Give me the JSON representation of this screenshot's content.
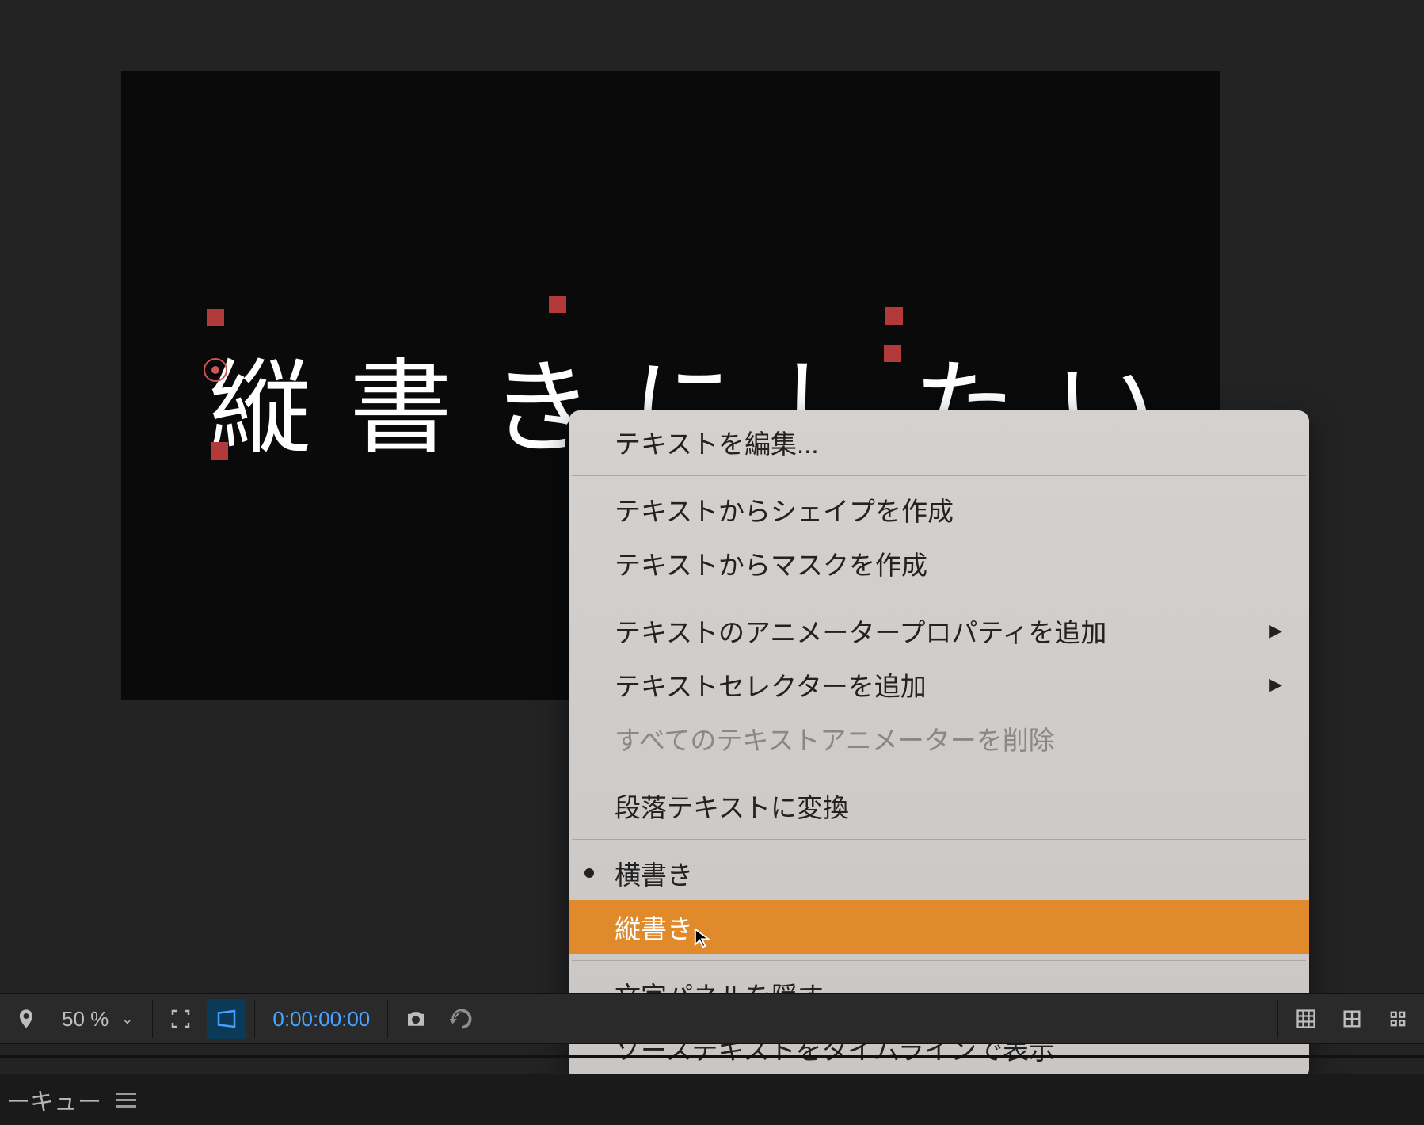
{
  "viewport": {
    "text_layer": "縦書きにしたい"
  },
  "context_menu": {
    "edit_text": "テキストを編集...",
    "create_shapes": "テキストからシェイプを作成",
    "create_masks": "テキストからマスクを作成",
    "add_animator_property": "テキストのアニメータープロパティを追加",
    "add_selector": "テキストセレクターを追加",
    "remove_all_animators": "すべてのテキストアニメーターを削除",
    "convert_paragraph": "段落テキストに変換",
    "horizontal": "横書き",
    "vertical": "縦書き",
    "hide_char_panel": "文字パネルを隠す",
    "show_source_timeline": "ソーステキストをタイムラインで表示"
  },
  "toolbar": {
    "zoom": "50 %",
    "timecode": "0:00:00:00"
  },
  "panel": {
    "tab_label": "ーキュー"
  },
  "colors": {
    "highlight": "#e08a2b",
    "handle": "#b33a3a"
  }
}
